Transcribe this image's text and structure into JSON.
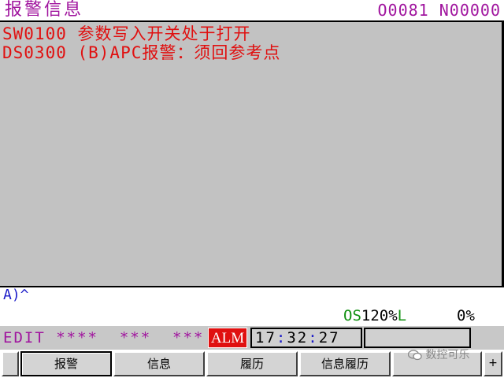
{
  "header": {
    "title": "报警信息",
    "program": "O0081 N00000"
  },
  "alarms": [
    "SW0100 参数写入开关处于打开",
    "DS0300 (B)APC报警：须回参考点"
  ],
  "input_line": "A)^",
  "status": {
    "os_label": "OS",
    "os_value": "120%",
    "l_label": "L",
    "l_value": "0%"
  },
  "mode_bar": {
    "mode": "EDIT ****  ***  ***",
    "alarm_badge": "ALM",
    "time_h": "17",
    "time_m": "32",
    "time_s": "27"
  },
  "softkeys": [
    {
      "label": "报警",
      "active": true
    },
    {
      "label": "信息",
      "active": false
    },
    {
      "label": "履历",
      "active": false
    },
    {
      "label": "信息履历",
      "active": false
    },
    {
      "label": "",
      "active": false
    }
  ],
  "softkey_right": "+",
  "watermark": "数控可乐",
  "colors": {
    "header_text": "#a0149e",
    "alarm_text": "#e01010",
    "pane_bg": "#c2c2c2",
    "alm_badge_bg": "#e01010",
    "os_text": "#109010"
  }
}
